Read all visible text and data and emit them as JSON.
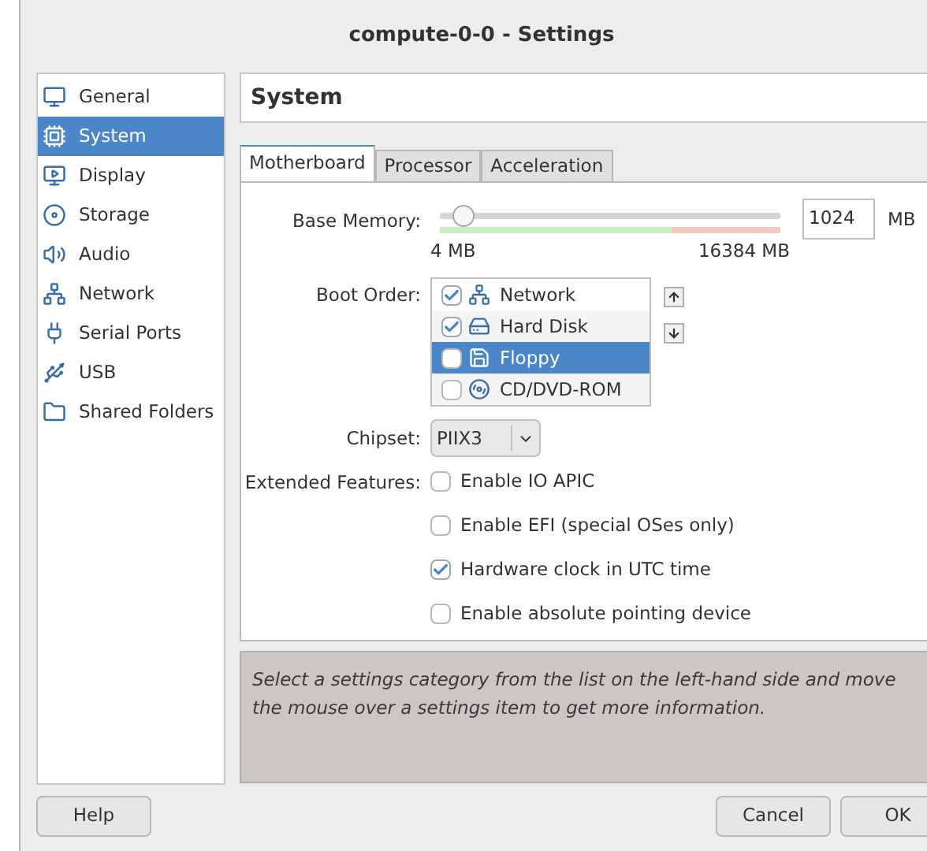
{
  "window": {
    "title": "compute-0-0 - Settings"
  },
  "sidebar": {
    "items": [
      {
        "label": "General",
        "selected": false
      },
      {
        "label": "System",
        "selected": true
      },
      {
        "label": "Display",
        "selected": false
      },
      {
        "label": "Storage",
        "selected": false
      },
      {
        "label": "Audio",
        "selected": false
      },
      {
        "label": "Network",
        "selected": false
      },
      {
        "label": "Serial Ports",
        "selected": false
      },
      {
        "label": "USB",
        "selected": false
      },
      {
        "label": "Shared Folders",
        "selected": false
      }
    ]
  },
  "page_title": "System",
  "tabs": [
    {
      "label": "Motherboard",
      "selected": true
    },
    {
      "label": "Processor",
      "selected": false
    },
    {
      "label": "Acceleration",
      "selected": false
    }
  ],
  "base_memory": {
    "label": "Base Memory:",
    "level": 0.07,
    "min_label": "4 MB",
    "max_label": "16384 MB",
    "value": "1024",
    "unit": "MB"
  },
  "boot_order": {
    "label": "Boot Order:",
    "items": [
      {
        "label": "Network",
        "checked": true,
        "selected": false
      },
      {
        "label": "Hard Disk",
        "checked": true,
        "selected": false
      },
      {
        "label": "Floppy",
        "checked": false,
        "selected": true
      },
      {
        "label": "CD/DVD-ROM",
        "checked": false,
        "selected": false
      }
    ]
  },
  "chipset": {
    "label": "Chipset:",
    "value": "PIIX3"
  },
  "extended_features": {
    "label": "Extended Features:",
    "options": [
      {
        "label": "Enable IO APIC",
        "checked": false
      },
      {
        "label": "Enable EFI (special OSes only)",
        "checked": false
      },
      {
        "label": "Hardware clock in UTC time",
        "checked": true
      },
      {
        "label": "Enable absolute pointing device",
        "checked": false
      }
    ]
  },
  "info_text": "Select a settings category from the list on the left-hand side and move the mouse over a settings item to get more information.",
  "buttons": {
    "help": "Help",
    "cancel": "Cancel",
    "ok": "OK"
  }
}
